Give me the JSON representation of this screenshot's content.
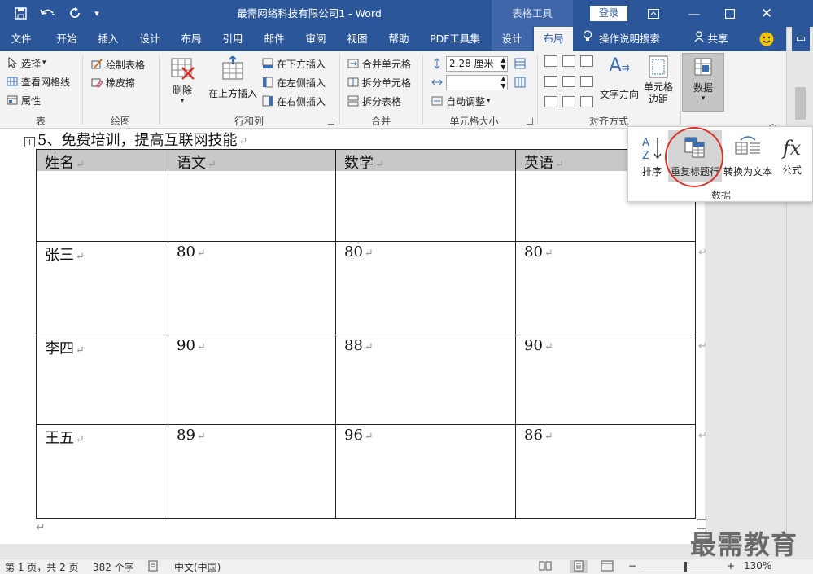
{
  "titlebar": {
    "doc_title": "最需网络科技有限公司1 - Word",
    "context_group": "表格工具",
    "login": "登录"
  },
  "tabs": [
    "文件",
    "开始",
    "插入",
    "设计",
    "布局",
    "引用",
    "邮件",
    "审阅",
    "视图",
    "帮助",
    "PDF工具集",
    "设计",
    "布局"
  ],
  "tell_me": "操作说明搜索",
  "share": "共享",
  "ribbon": {
    "table_group": {
      "select": "选择",
      "gridlines": "查看网格线",
      "properties": "属性",
      "label": "表"
    },
    "draw_group": {
      "draw_table": "绘制表格",
      "eraser": "橡皮擦",
      "label": "绘图"
    },
    "rows_cols": {
      "delete": "删除",
      "insert_above": "在上方插入",
      "insert_below": "在下方插入",
      "insert_left": "在左侧插入",
      "insert_right": "在右侧插入",
      "label": "行和列"
    },
    "merge": {
      "merge_cells": "合并单元格",
      "split_cells": "拆分单元格",
      "split_table": "拆分表格",
      "label": "合并"
    },
    "cell_size": {
      "height": "2.28 厘米",
      "width": "",
      "autofit": "自动调整",
      "label": "单元格大小"
    },
    "alignment": {
      "text_direction": "文字方向",
      "cell_margins_1": "单元格",
      "cell_margins_2": "边距",
      "label": "对齐方式"
    },
    "data": {
      "label": "数据"
    }
  },
  "data_panel": {
    "sort": "排序",
    "repeat_header": "重复标题行",
    "convert_text": "转换为文本",
    "formula": "公式",
    "label": "数据"
  },
  "document": {
    "heading": "5、免费培训，提高互联网技能",
    "headers": [
      "姓名",
      "语文",
      "数学",
      "英语"
    ],
    "rows": [
      [
        "张三",
        "80",
        "80",
        "80"
      ],
      [
        "李四",
        "90",
        "88",
        "90"
      ],
      [
        "王五",
        "89",
        "96",
        "86"
      ]
    ]
  },
  "statusbar": {
    "page": "第 1 页，共 2 页",
    "words": "382 个字",
    "language": "中文(中国)",
    "zoom": "130%"
  },
  "watermark": "最需教育"
}
